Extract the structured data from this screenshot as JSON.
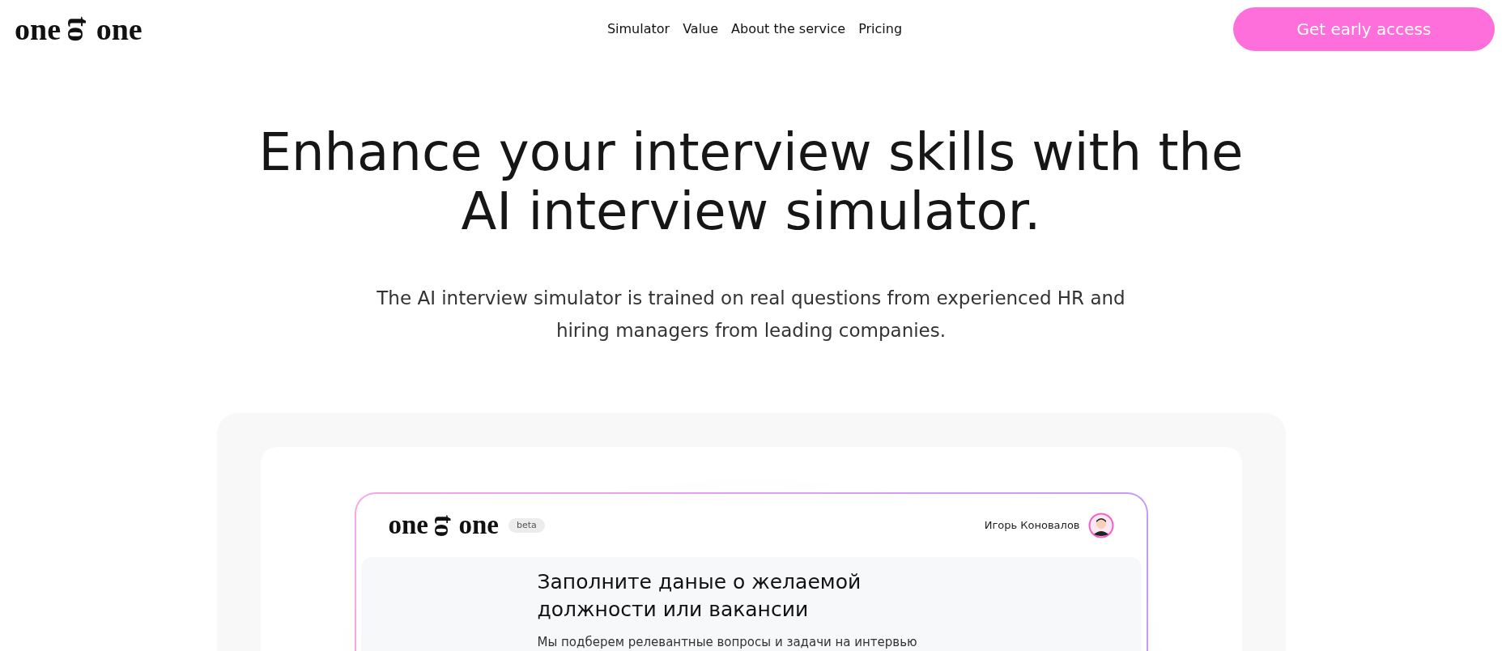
{
  "header": {
    "logo": {
      "left": "one",
      "middle": "to",
      "right": "one"
    },
    "nav": [
      {
        "label": "Simulator"
      },
      {
        "label": "Value"
      },
      {
        "label": "About the service"
      },
      {
        "label": "Pricing"
      }
    ],
    "cta": "Get early access"
  },
  "hero": {
    "title_lines": [
      "Enhance your interview skills with the",
      "AI interview simulator."
    ],
    "subtitle_lines": [
      "The AI interview simulator is trained on real questions from experienced HR and",
      "hiring managers from leading companies."
    ]
  },
  "app_preview": {
    "logo": {
      "left": "one",
      "middle": "to",
      "right": "one"
    },
    "badge": "beta",
    "user_name": "Игорь Коновалов",
    "heading_lines": [
      "Заполните даные о желаемой",
      "должности или вакансии"
    ],
    "description": "Мы подберем релевантные вопросы и задачи на интервью"
  }
}
